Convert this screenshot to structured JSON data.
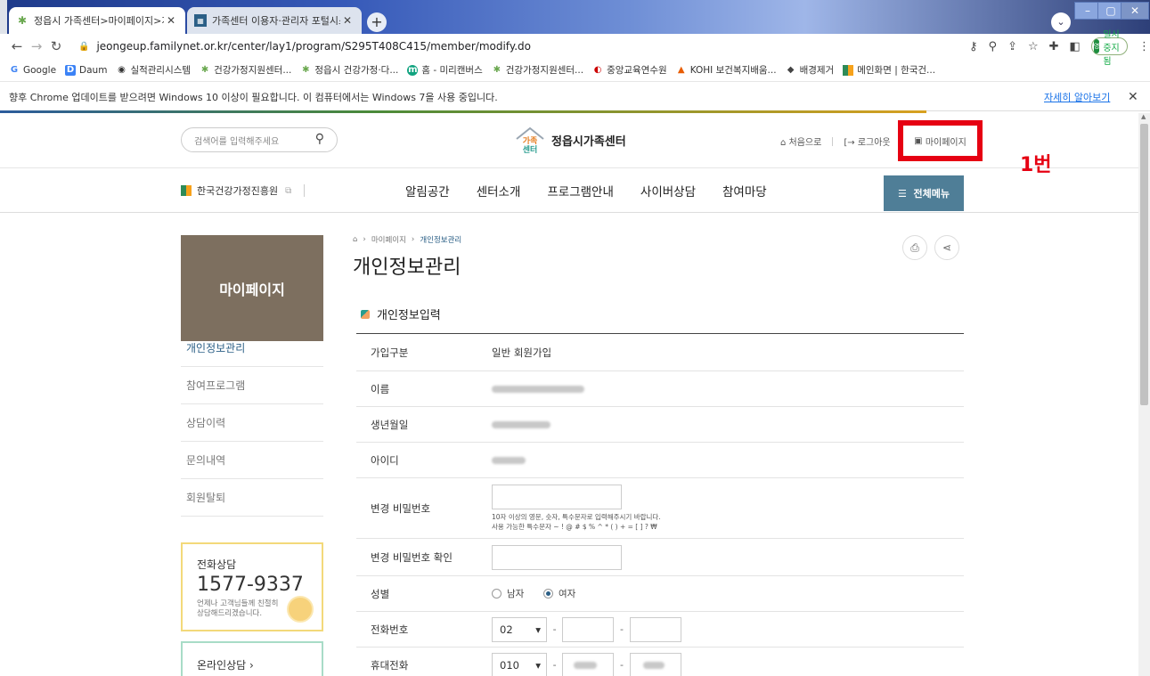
{
  "browser": {
    "tabs": [
      {
        "title": "정읍시 가족센터>마이페이지>개",
        "active": true
      },
      {
        "title": "가족센터 이용자·관리자 포털시스",
        "active": false
      }
    ],
    "new_tab": "+",
    "url": "jeongeup.familynet.or.kr/center/lay1/program/S295T408C415/member/modify.do",
    "sync_badge": "영중",
    "sync_label": "일시중지됨",
    "bookmarks": [
      "Google",
      "Daum",
      "실적관리시스템",
      "건강가정지원센터...",
      "정읍시 건강가정·다...",
      "홈 - 미리캔버스",
      "건강가정지원센터...",
      "중앙교육연수원",
      "KOHI 보건복지배움...",
      "배경제거",
      "메인화면 | 한국건..."
    ],
    "infobar_text": "향후 Chrome 업데이트를 받으려면 Windows 10 이상이 필요합니다. 이 컴퓨터에서는 Windows 7을 사용 중입니다.",
    "infobar_link": "자세히 알아보기",
    "colors": {
      "tabstrip": "#1e3a8a",
      "link": "#1a73e8"
    }
  },
  "header": {
    "search_placeholder": "검색어를 입력해주세요",
    "logo_mark_top": "가족",
    "logo_mark_bottom": "센터",
    "site_name": "정읍시가족센터",
    "home_link": "처음으로",
    "logout_link": "로그아웃",
    "mypage_link": "마이페이지",
    "annotation": "1번"
  },
  "gnb": {
    "kidf": "한국건강가정진흥원",
    "menu": [
      "알림공간",
      "센터소개",
      "프로그램안내",
      "사이버상담",
      "참여마당"
    ],
    "all_menu": "전체메뉴"
  },
  "lnb": {
    "title": "마이페이지",
    "items": [
      "개인정보관리",
      "참여프로그램",
      "상담이력",
      "문의내역",
      "회원탈퇴"
    ],
    "active_index": 0
  },
  "call": {
    "label": "전화상담",
    "number": "1577-9337",
    "desc": "언제나 고객님들께 친절히 상담해드리겠습니다."
  },
  "online": {
    "label": "온라인상담"
  },
  "content": {
    "breadcrumb": [
      "마이페이지",
      "개인정보관리"
    ],
    "title": "개인정보관리",
    "section": "개인정보입력",
    "rows": {
      "join_type_label": "가입구분",
      "join_type_value": "일반 회원가입",
      "name_label": "이름",
      "birth_label": "생년월일",
      "id_label": "아이디",
      "pw_label": "변경 비밀번호",
      "pw_help_1": "10자 이상의 영문, 숫자, 특수문자로 입력해주시기 바랍니다.",
      "pw_help_2": "사용 가능한 특수문자 ~ ! @ # $ % ^ * ( ) + = [ ] ? ₩",
      "pw_confirm_label": "변경 비밀번호 확인",
      "gender_label": "성별",
      "gender_male": "남자",
      "gender_female": "여자",
      "gender_selected": "female",
      "phone_label": "전화번호",
      "phone_prefix": "02",
      "mobile_label": "휴대전화",
      "mobile_prefix": "010"
    }
  }
}
